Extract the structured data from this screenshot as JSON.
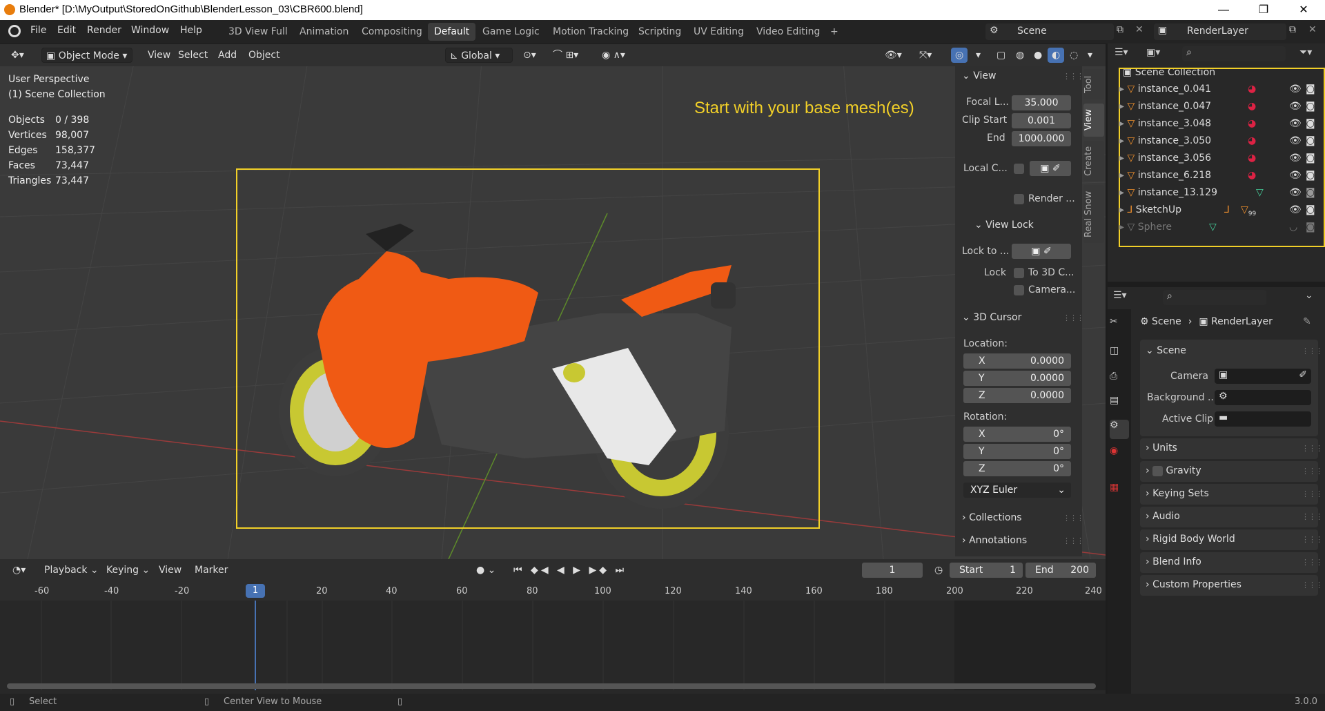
{
  "window": {
    "title": "Blender* [D:\\MyOutput\\StoredOnGithub\\BlenderLesson_03\\CBR600.blend]"
  },
  "menus": [
    "File",
    "Edit",
    "Render",
    "Window",
    "Help"
  ],
  "workspaces": [
    "3D View Full",
    "Animation",
    "Compositing",
    "Default",
    "Game Logic",
    "Motion Tracking",
    "Scripting",
    "UV Editing",
    "Video Editing",
    "+"
  ],
  "active_workspace": "Default",
  "scene": {
    "label": "Scene",
    "render_layer": "RenderLayer"
  },
  "viewport_header": {
    "mode": "Object Mode",
    "menus": [
      "View",
      "Select",
      "Add",
      "Object"
    ],
    "orientation": "Global"
  },
  "overlay_info": {
    "perspective": "User Perspective",
    "collection": "(1) Scene Collection",
    "stats": [
      {
        "k": "Objects",
        "v": "0 / 398"
      },
      {
        "k": "Vertices",
        "v": "98,007"
      },
      {
        "k": "Edges",
        "v": "158,377"
      },
      {
        "k": "Faces",
        "v": "73,447"
      },
      {
        "k": "Triangles",
        "v": "73,447"
      }
    ]
  },
  "annotation": "Start with your base mesh(es)",
  "npanel": {
    "tabs": [
      "Tool",
      "View",
      "Create",
      "Real Snow"
    ],
    "view": {
      "title": "View",
      "focal_label": "Focal L...",
      "focal": "35.000",
      "clip_start_label": "Clip Start",
      "clip_start": "0.001",
      "end_label": "End",
      "clip_end": "1000.000",
      "local_label": "Local C...",
      "render_label": "Render ..."
    },
    "view_lock": {
      "title": "View Lock",
      "lock_to": "Lock to ...",
      "lock": "Lock",
      "to3d": "To 3D C...",
      "camera": "Camera..."
    },
    "cursor": {
      "title": "3D Cursor",
      "location": "Location:",
      "lx": "0.0000",
      "ly": "0.0000",
      "lz": "0.0000",
      "rotation": "Rotation:",
      "rx": "0°",
      "ry": "0°",
      "rz": "0°",
      "mode": "XYZ Euler",
      "x": "X",
      "y": "Y",
      "z": "Z"
    },
    "collections": "Collections",
    "annotations": "Annotations"
  },
  "timeline": {
    "menus": [
      "Playback",
      "Keying",
      "View",
      "Marker"
    ],
    "frame": "1",
    "start_label": "Start",
    "start": "1",
    "end_label": "End",
    "end": "200",
    "current": "1",
    "ticks": [
      "-60",
      "-40",
      "-20",
      "20",
      "40",
      "60",
      "80",
      "100",
      "120",
      "140",
      "160",
      "180",
      "200",
      "220",
      "240"
    ]
  },
  "outliner": {
    "root": "Scene Collection",
    "items": [
      "instance_0.041",
      "instance_0.047",
      "instance_3.048",
      "instance_3.050",
      "instance_3.056",
      "instance_6.218",
      "instance_13.129",
      "SketchUp",
      "Sphere"
    ],
    "badge": "99"
  },
  "properties": {
    "breadcrumb_scene": "Scene",
    "breadcrumb_layer": "RenderLayer",
    "section": "Scene",
    "camera_label": "Camera",
    "background_label": "Background ...",
    "clip_label": "Active Clip",
    "panels": [
      "Units",
      "Gravity",
      "Keying Sets",
      "Audio",
      "Rigid Body World",
      "Blend Info",
      "Custom Properties"
    ]
  },
  "status": {
    "select": "Select",
    "center": "Center View to Mouse",
    "version": "3.0.0"
  },
  "colors": {
    "accent": "#4772b3",
    "annotation": "#f2d028",
    "selection": "#f2d028",
    "bike": "#f05a14",
    "rim": "#c8c832"
  }
}
